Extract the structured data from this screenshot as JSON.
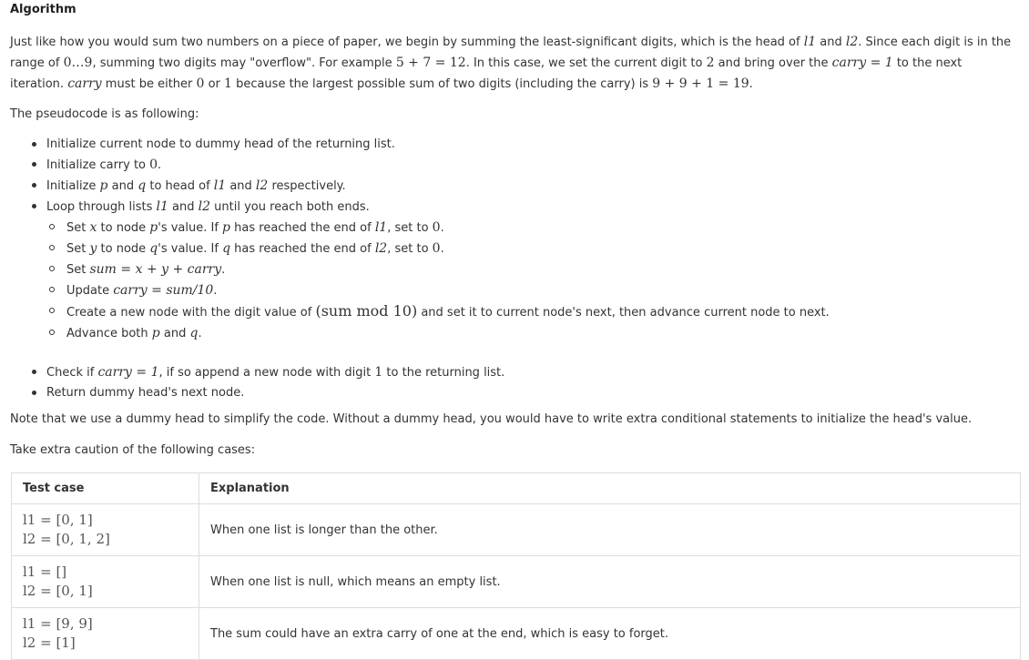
{
  "title": "Algorithm",
  "para1": {
    "t1": "Just like how you would sum two numbers on a piece of paper, we begin by summing the least-significant digits, which is the head of ",
    "m1": "l1",
    "t2": " and ",
    "m2": "l2",
    "t3": ". Since each digit is in the range of ",
    "m3": "0…9",
    "t4": ", summing two digits may \"overflow\". For example ",
    "m4": "5 + 7 = 12",
    "t5": ". In this case, we set the current digit to ",
    "m5": "2",
    "t6": " and bring over the ",
    "m6": "carry = 1",
    "t7": " to the next iteration. ",
    "m7": "carry",
    "t8": " must be either ",
    "m8": "0",
    "t9": " or ",
    "m9": "1",
    "t10": " because the largest possible sum of two digits (including the carry) is ",
    "m10": "9 + 9 + 1 = 19",
    "t11": "."
  },
  "para2": "The pseudocode is as following:",
  "steps": {
    "s1": "Initialize current node to dummy head of the returning list.",
    "s2_t": "Initialize carry to ",
    "s2_m": "0",
    "s2_e": ".",
    "s3_t1": "Initialize ",
    "s3_m1": "p",
    "s3_t2": " and ",
    "s3_m2": "q",
    "s3_t3": " to head of ",
    "s3_m3": "l1",
    "s3_t4": " and ",
    "s3_m4": "l2",
    "s3_t5": " respectively.",
    "s4_t1": "Loop through lists ",
    "s4_m1": "l1",
    "s4_t2": " and ",
    "s4_m2": "l2",
    "s4_t3": " until you reach both ends.",
    "sub1_t1": "Set ",
    "sub1_m1": "x",
    "sub1_t2": " to node ",
    "sub1_m2": "p",
    "sub1_t3": "'s value. If ",
    "sub1_m3": "p",
    "sub1_t4": " has reached the end of ",
    "sub1_m4": "l1",
    "sub1_t5": ", set to ",
    "sub1_m5": "0",
    "sub1_t6": ".",
    "sub2_t1": "Set ",
    "sub2_m1": "y",
    "sub2_t2": " to node ",
    "sub2_m2": "q",
    "sub2_t3": "'s value. If ",
    "sub2_m3": "q",
    "sub2_t4": " has reached the end of ",
    "sub2_m4": "l2",
    "sub2_t5": ", set to ",
    "sub2_m5": "0",
    "sub2_t6": ".",
    "sub3_t1": "Set ",
    "sub3_m1": "sum = x + y + carry",
    "sub3_t2": ".",
    "sub4_t1": "Update ",
    "sub4_m1": "carry = sum/10",
    "sub4_t2": ".",
    "sub5_t1": "Create a new node with the digit value of ",
    "sub5_m1": "(sum mod 10)",
    "sub5_t2": " and set it to current node's next, then advance current node to next.",
    "sub6_t1": "Advance both ",
    "sub6_m1": "p",
    "sub6_t2": " and ",
    "sub6_m2": "q",
    "sub6_t3": ".",
    "s5_t1": "Check if ",
    "s5_m1": "carry = 1",
    "s5_t2": ", if so append a new node with digit ",
    "s5_m2": "1",
    "s5_t3": " to the returning list.",
    "s6": "Return dummy head's next node."
  },
  "para3": "Note that we use a dummy head to simplify the code. Without a dummy head, you would have to write extra conditional statements to initialize the head's value.",
  "para4": "Take extra caution of the following cases:",
  "table": {
    "headers": [
      "Test case",
      "Explanation"
    ],
    "rows": [
      {
        "l1": "l1 = [0, 1]",
        "l2": "l2 = [0, 1, 2]",
        "explanation": "When one list is longer than the other."
      },
      {
        "l1": "l1 = []",
        "l2": "l2 = [0, 1]",
        "explanation": "When one list is null, which means an empty list."
      },
      {
        "l1": "l1 = [9, 9]",
        "l2": "l2 = [1]",
        "explanation": "The sum could have an extra carry of one at the end, which is easy to forget."
      }
    ]
  }
}
